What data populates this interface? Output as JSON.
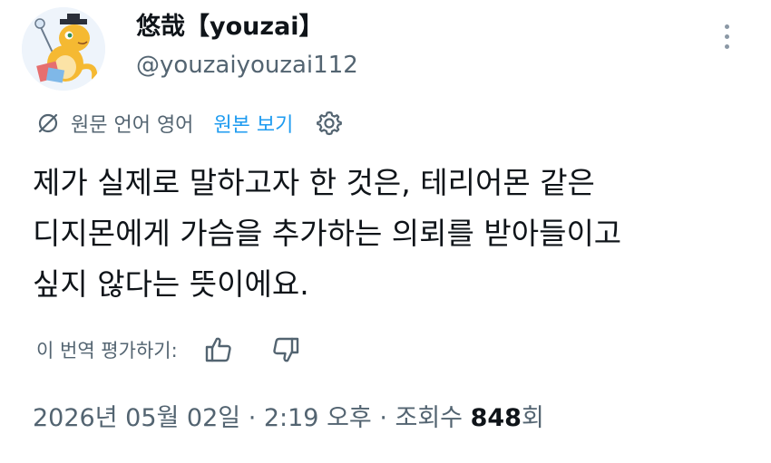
{
  "author": {
    "display_name": "悠哉【youzai】",
    "handle": "@youzaiyouzai112"
  },
  "translation_bar": {
    "original_language_text": "원문 언어 영어",
    "show_original_label": "원본 보기"
  },
  "tweet": {
    "lines": [
      "제가 실제로 말하고자 한 것은, 테리어몬 같은",
      "디지몬에게 가슴을 추가하는 의뢰를 받아들이고",
      "싶지 않다는 뜻이에요."
    ]
  },
  "rating": {
    "label": "이 번역 평가하기:"
  },
  "meta": {
    "date_time": "2026년 05월 02일 · 2:19 오후 · 조회수 ",
    "views_count": "848",
    "views_suffix": "회"
  },
  "icons": {
    "more": "more-vertical-icon",
    "translate": "globe-off-icon",
    "settings": "gear-icon",
    "rate_up": "thumbs-up-icon",
    "rate_down": "thumbs-down-icon"
  },
  "colors": {
    "link": "#1d9bf0",
    "text_primary": "#0f1419",
    "text_secondary": "#536471"
  }
}
